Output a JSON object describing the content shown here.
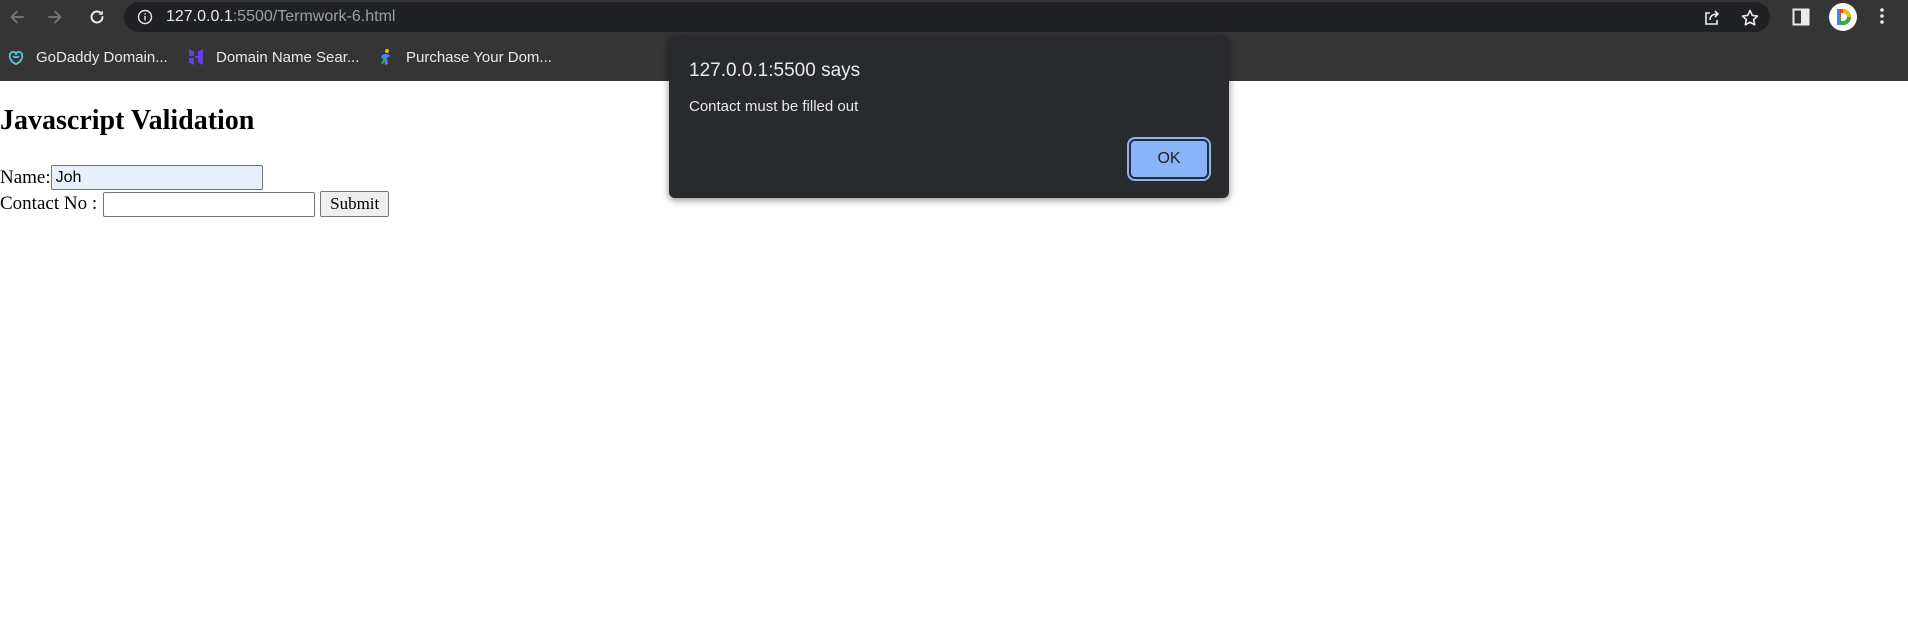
{
  "browser": {
    "url_host": "127.0.0.1",
    "url_rest": ":5500/Termwork-6.html",
    "profile_initial": "D",
    "bookmarks": [
      {
        "label": "GoDaddy Domain...",
        "icon": "godaddy-icon"
      },
      {
        "label": "Domain Name Sear...",
        "icon": "hostinger-icon"
      },
      {
        "label": "Purchase Your Dom...",
        "icon": "domain-icon"
      }
    ]
  },
  "page": {
    "heading": "Javascript Validation",
    "name_label": "Name:",
    "name_value": "Joh",
    "contact_label": "Contact No :",
    "contact_value": "",
    "submit_label": "Submit"
  },
  "dialog": {
    "title": "127.0.0.1:5500 says",
    "message": "Contact must be filled out",
    "ok_label": "OK"
  },
  "colors": {
    "chrome_bg": "#353535",
    "omnibox_bg": "#202124",
    "dialog_bg": "#292a2d",
    "dialog_button": "#8ab4f8",
    "autofill_bg": "#e8f0fe"
  }
}
